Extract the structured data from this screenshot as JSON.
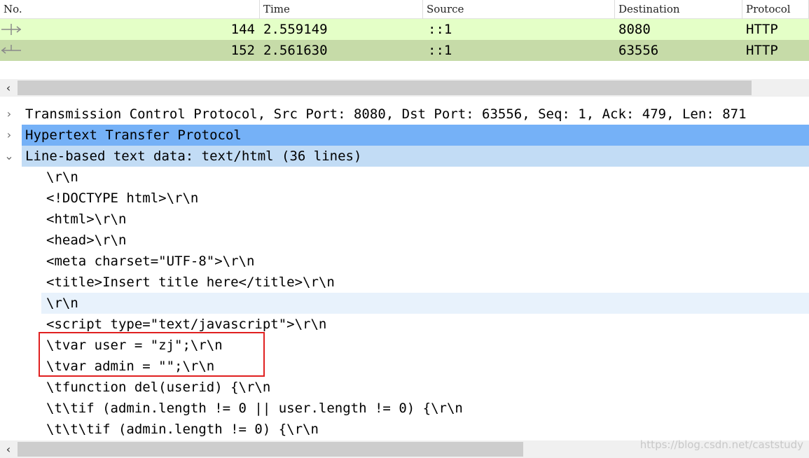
{
  "packet_list": {
    "columns": {
      "no": "No.",
      "time": "Time",
      "source": "Source",
      "destination": "Destination",
      "protocol": "Protocol"
    },
    "rows": [
      {
        "no": "144",
        "time": "2.559149",
        "source": "::1",
        "destination": "8080",
        "protocol": "HTTP",
        "row_color": "#e4ffc7"
      },
      {
        "no": "152",
        "time": "2.561630",
        "source": "::1",
        "destination": "63556",
        "protocol": "HTTP",
        "row_color": "#c6dba8"
      }
    ]
  },
  "details": {
    "tree": [
      {
        "label": "Transmission Control Protocol, Src Port: 8080, Dst Port: 63556, Seq: 1, Ack: 479, Len: 871",
        "expanded": false
      },
      {
        "label": "Hypertext Transfer Protocol",
        "expanded": false,
        "selected": true
      },
      {
        "label": "Line-based text data: text/html (36 lines)",
        "expanded": true
      }
    ],
    "lines": [
      "\\r\\n",
      "<!DOCTYPE html>\\r\\n",
      "<html>\\r\\n",
      "<head>\\r\\n",
      "<meta charset=\"UTF-8\">\\r\\n",
      "<title>Insert title here</title>\\r\\n",
      "\\r\\n",
      "<script type=\"text/javascript\">\\r\\n",
      "\\tvar user = \"zj\";\\r\\n",
      "\\tvar admin = \"\";\\r\\n",
      "\\tfunction del(userid) {\\r\\n",
      "\\t\\tif (admin.length != 0 || user.length != 0) {\\r\\n",
      "\\t\\t\\tif (admin.length != 0) {\\r\\n"
    ]
  },
  "icons": {
    "collapsed": "chevron-right-icon",
    "expanded": "chevron-down-icon",
    "scroll_left": "chevron-left-icon"
  },
  "colors": {
    "selected": "#75b1f7",
    "related": "#c2dcf5",
    "highlight_box": "#e02020"
  },
  "watermark": "https://blog.csdn.net/caststudy"
}
